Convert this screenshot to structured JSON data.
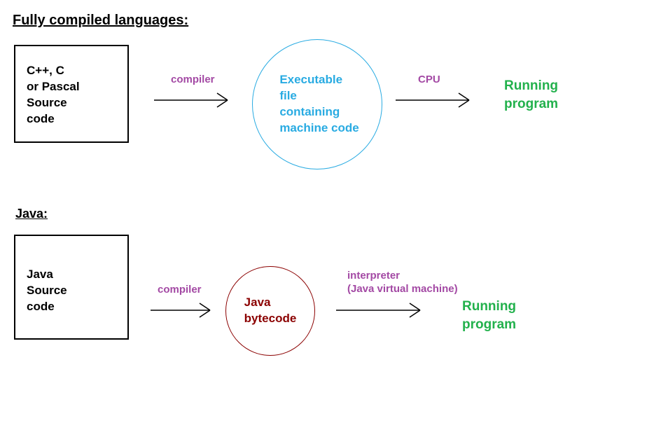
{
  "headings": {
    "compiled": "Fully compiled languages:",
    "java": "Java:"
  },
  "flow_compiled": {
    "source_box": "C++, C\nor Pascal\nSource\ncode",
    "arrow1_label": "compiler",
    "intermediate": "Executable\nfile\ncontaining\nmachine code",
    "arrow2_label": "CPU",
    "result": "Running\nprogram"
  },
  "flow_java": {
    "source_box": "Java\nSource\ncode",
    "arrow1_label": "compiler",
    "intermediate": "Java\nbytecode",
    "arrow2_label": "interpreter\n(Java virtual machine)",
    "result": "Running\nprogram"
  },
  "colors": {
    "blue": "#29abe2",
    "dark_red": "#8b0000",
    "green": "#22b14c",
    "purple": "#a349a4",
    "black": "#000000"
  }
}
